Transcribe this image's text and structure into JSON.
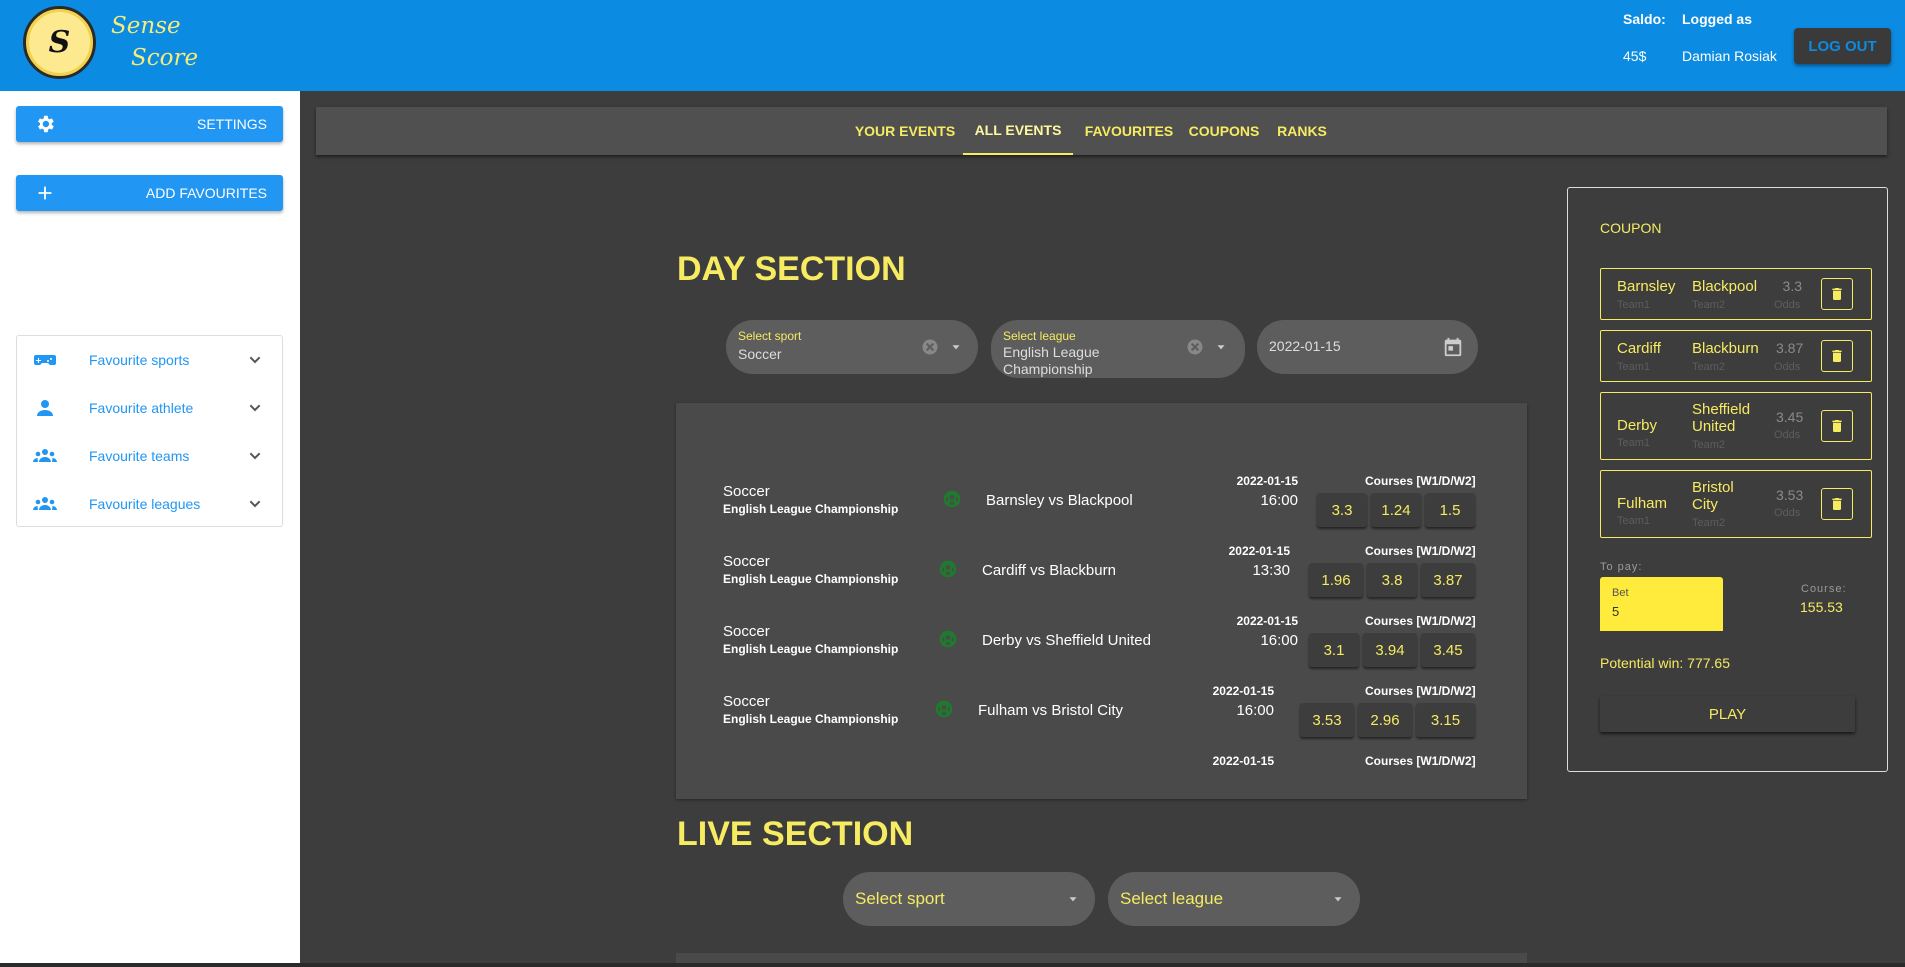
{
  "header": {
    "logo_letter": "S",
    "logo_line1": "Sense",
    "logo_line2": "Score",
    "saldo_label": "Saldo:",
    "saldo_value": "45$",
    "logged_label": "Logged as",
    "logged_user": "Damian Rosiak",
    "logout_label": "LOG OUT"
  },
  "sidebar": {
    "settings_label": "SETTINGS",
    "add_favourites_label": "ADD FAVOURITES",
    "favourites": [
      {
        "label": "Favourite sports",
        "icon": "gamepad-icon"
      },
      {
        "label": "Favourite athlete",
        "icon": "person-icon"
      },
      {
        "label": "Favourite teams",
        "icon": "group-icon"
      },
      {
        "label": "Favourite leagues",
        "icon": "group-icon"
      }
    ]
  },
  "tabs": [
    "YOUR EVENTS",
    "ALL EVENTS",
    "FAVOURITES",
    "COUPONS",
    "RANKS"
  ],
  "active_tab": "ALL EVENTS",
  "day_section": {
    "title": "DAY SECTION",
    "sport_label": "Select sport",
    "sport_value": "Soccer",
    "league_label": "Select league",
    "league_value_line1": "English League",
    "league_value_line2": "Championship",
    "date_value": "2022-01-15",
    "events": [
      {
        "sport": "Soccer",
        "league": "English League Championship",
        "match": "Barnsley vs Blackpool",
        "date": "2022-01-15",
        "time": "16:00",
        "courses_label": "Courses [W1/D/W2]",
        "odds": [
          "3.3",
          "1.24",
          "1.5"
        ]
      },
      {
        "sport": "Soccer",
        "league": "English League Championship",
        "match": "Cardiff vs Blackburn",
        "date": "2022-01-15",
        "time": "13:30",
        "courses_label": "Courses [W1/D/W2]",
        "odds": [
          "1.96",
          "3.8",
          "3.87"
        ]
      },
      {
        "sport": "Soccer",
        "league": "English League Championship",
        "match": "Derby vs Sheffield United",
        "date": "2022-01-15",
        "time": "16:00",
        "courses_label": "Courses [W1/D/W2]",
        "odds": [
          "3.1",
          "3.94",
          "3.45"
        ]
      },
      {
        "sport": "Soccer",
        "league": "English League Championship",
        "match": "Fulham vs Bristol City",
        "date": "2022-01-15",
        "time": "16:00",
        "courses_label": "Courses [W1/D/W2]",
        "odds": [
          "3.53",
          "2.96",
          "3.15"
        ]
      }
    ],
    "partial_date": "2022-01-15",
    "partial_courses": "Courses [W1/D/W2]"
  },
  "live_section": {
    "title": "LIVE SECTION",
    "sport_placeholder": "Select sport",
    "league_placeholder": "Select league"
  },
  "coupon": {
    "title": "COUPON",
    "team1_caption": "Team1",
    "team2_caption": "Team2",
    "odds_caption": "Odds",
    "rows": [
      {
        "team1": "Barnsley",
        "team2": "Blackpool",
        "odds": "3.3"
      },
      {
        "team1": "Cardiff",
        "team2": "Blackburn",
        "odds": "3.87"
      },
      {
        "team1": "Derby",
        "team2": "Sheffield United",
        "odds": "3.45"
      },
      {
        "team1": "Fulham",
        "team2": "Bristol City",
        "odds": "3.53"
      }
    ],
    "to_pay_label": "To pay:",
    "bet_label": "Bet",
    "bet_value": "5",
    "course_label": "Course:",
    "course_value": "155.53",
    "potential_win": "Potential win: 777.65",
    "play_label": "PLAY"
  },
  "colors": {
    "header_blue": "#0b8be2",
    "accent_yellow": "#f6eb61",
    "button_blue": "#2196f3",
    "main_bg": "#3d3d3d"
  }
}
